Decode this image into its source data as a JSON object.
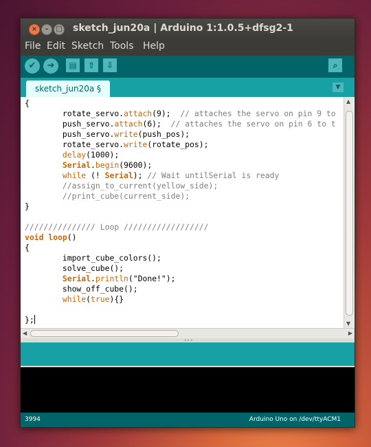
{
  "window": {
    "title": "sketch_jun20a | Arduino 1:1.0.5+dfsg2-1"
  },
  "menu": [
    "File",
    "Edit",
    "Sketch",
    "Tools",
    "Help"
  ],
  "toolbar": {
    "buttons": [
      "verify",
      "upload",
      "new",
      "open",
      "save"
    ],
    "serial_monitor": "serial-monitor"
  },
  "tabs": [
    {
      "label": "sketch_jun20a §"
    }
  ],
  "editor": {
    "lines": [
      "{",
      "        rotate_servo.attach(9);  // attaches the servo on pin 9 to",
      "        push_servo.attach(6);  // attaches the servo on pin 6 to t",
      "        push_servo.write(push_pos);",
      "        rotate_servo.write(rotate_pos);",
      "        delay(1000);",
      "        Serial.begin(9600);",
      "        while (! Serial); // Wait untilSerial is ready",
      "        //assign_to_current(yellow_side);",
      "        //print_cube(current_side);",
      "}",
      "",
      "/////////////// Loop //////////////////",
      "void loop()",
      "{",
      "        import_cube_colors();",
      "        solve_cube();",
      "        Serial.println(\"Done!\");",
      "        show_off_cube();",
      "        while(true){}",
      "",
      "};"
    ]
  },
  "status": {
    "line": "3994",
    "board": "Arduino Uno on /dev/ttyACM1"
  },
  "colors": {
    "toolbar": "#006468",
    "tab_bar": "#17a1a5",
    "keyword": "#cc6600",
    "comment": "#7e7e7e"
  }
}
